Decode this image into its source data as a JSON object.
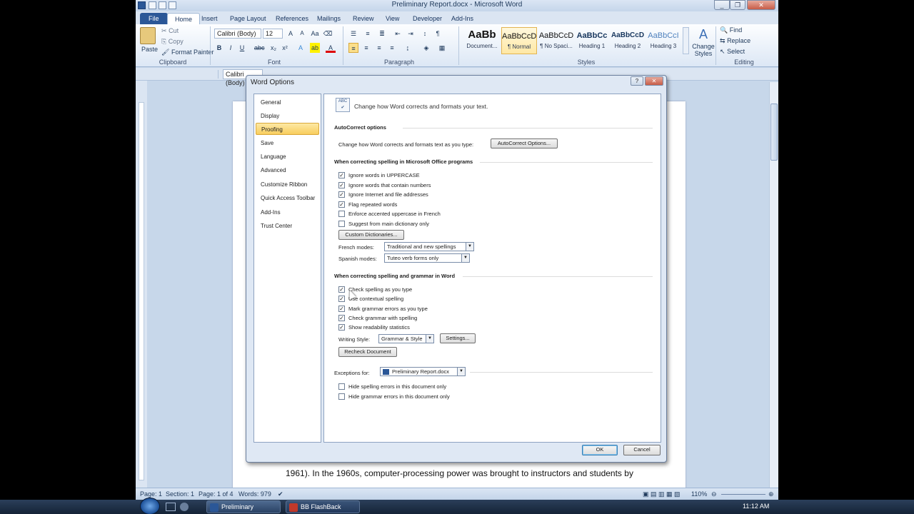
{
  "window": {
    "title": "Preliminary Report.docx - Microsoft Word"
  },
  "ribbon_tabs": [
    "File",
    "Home",
    "Insert",
    "Page Layout",
    "References",
    "Mailings",
    "Review",
    "View",
    "Developer",
    "Add-Ins"
  ],
  "clipboard": {
    "paste": "Paste",
    "cut": "Cut",
    "copy": "Copy",
    "format_painter": "Format Painter",
    "label": "Clipboard"
  },
  "font": {
    "family": "Calibri (Body)",
    "size": "12",
    "label": "Font"
  },
  "paragraph": {
    "label": "Paragraph"
  },
  "styles": {
    "items": [
      {
        "sample": "AaBb",
        "name": "Document..."
      },
      {
        "sample": "AaBbCcD",
        "name": "¶ Normal"
      },
      {
        "sample": "AaBbCcD",
        "name": "¶ No Spaci..."
      },
      {
        "sample": "AaBbCc",
        "name": "Heading 1"
      },
      {
        "sample": "AaBbCcD",
        "name": "Heading 2"
      },
      {
        "sample": "AaBbCcI",
        "name": "Heading 3"
      }
    ],
    "change_styles": "Change Styles",
    "label": "Styles"
  },
  "editing": {
    "find": "Find",
    "replace": "Replace",
    "select": "Select",
    "label": "Editing"
  },
  "document": {
    "visible_text": "1961).  In the 1960s, computer-processing power was brought to instructors and students by"
  },
  "status_bar": {
    "page": "Page: 1",
    "section": "Section: 1",
    "page_of": "Page: 1 of 4",
    "words": "Words: 979",
    "zoom": "110%"
  },
  "dialog": {
    "title": "Word Options",
    "nav": [
      "General",
      "Display",
      "Proofing",
      "Save",
      "Language",
      "Advanced",
      "Customize Ribbon",
      "Quick Access Toolbar",
      "Add-Ins",
      "Trust Center"
    ],
    "selected_nav": "Proofing",
    "intro": "Change how Word corrects and formats your text.",
    "autocorrect": {
      "header": "AutoCorrect options",
      "desc": "Change how Word corrects and formats text as you type:",
      "button": "AutoCorrect Options..."
    },
    "office_spelling": {
      "header": "When correcting spelling in Microsoft Office programs",
      "options": [
        {
          "label": "Ignore words in UPPERCASE",
          "checked": true
        },
        {
          "label": "Ignore words that contain numbers",
          "checked": true
        },
        {
          "label": "Ignore Internet and file addresses",
          "checked": true
        },
        {
          "label": "Flag repeated words",
          "checked": true
        },
        {
          "label": "Enforce accented uppercase in French",
          "checked": false
        },
        {
          "label": "Suggest from main dictionary only",
          "checked": false
        }
      ],
      "custom_dictionaries": "Custom Dictionaries...",
      "french_label": "French modes:",
      "french_value": "Traditional and new spellings",
      "spanish_label": "Spanish modes:",
      "spanish_value": "Tuteo verb forms only"
    },
    "word_spelling": {
      "header": "When correcting spelling and grammar in Word",
      "options": [
        {
          "label": "Check spelling as you type",
          "checked": true
        },
        {
          "label": "Use contextual spelling",
          "checked": true
        },
        {
          "label": "Mark grammar errors as you type",
          "checked": true
        },
        {
          "label": "Check grammar with spelling",
          "checked": true
        },
        {
          "label": "Show readability statistics",
          "checked": true
        }
      ],
      "writing_style_label": "Writing Style:",
      "writing_style_value": "Grammar & Style",
      "settings": "Settings...",
      "recheck": "Recheck Document"
    },
    "exceptions": {
      "label": "Exceptions for:",
      "value": "Preliminary Report.docx",
      "options": [
        {
          "label": "Hide spelling errors in this document only",
          "checked": false
        },
        {
          "label": "Hide grammar errors in this document only",
          "checked": false
        }
      ]
    },
    "ok": "OK",
    "cancel": "Cancel"
  },
  "taskbar": {
    "items": [
      "Preliminary Report....",
      "BB FlashBack Expres..."
    ],
    "clock": "11:12 AM"
  }
}
